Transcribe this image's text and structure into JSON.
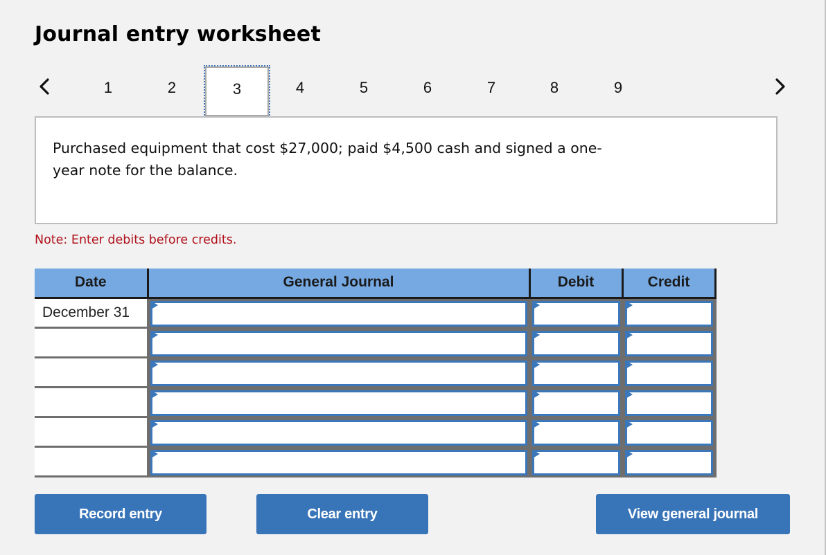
{
  "title": "Journal entry worksheet",
  "pager": {
    "prev_icon": "chevron-left-icon",
    "next_icon": "chevron-right-icon",
    "pages": [
      "1",
      "2",
      "3",
      "4",
      "5",
      "6",
      "7",
      "8",
      "9"
    ],
    "active_page": "3"
  },
  "description": "Purchased equipment that cost $27,000; paid $4,500 cash and signed a one-year note for the balance.",
  "description_lines": [
    "Purchased equipment that cost $27,000; paid $4,500 cash and signed a one-",
    "year note for the balance."
  ],
  "note": "Note: Enter debits before credits.",
  "table": {
    "headers": {
      "date": "Date",
      "general_journal": "General Journal",
      "debit": "Debit",
      "credit": "Credit"
    },
    "rows": [
      {
        "date": "December 31",
        "account": "",
        "debit": "",
        "credit": ""
      },
      {
        "date": "",
        "account": "",
        "debit": "",
        "credit": ""
      },
      {
        "date": "",
        "account": "",
        "debit": "",
        "credit": ""
      },
      {
        "date": "",
        "account": "",
        "debit": "",
        "credit": ""
      },
      {
        "date": "",
        "account": "",
        "debit": "",
        "credit": ""
      },
      {
        "date": "",
        "account": "",
        "debit": "",
        "credit": ""
      }
    ]
  },
  "buttons": {
    "record": "Record entry",
    "clear": "Clear entry",
    "view": "View general journal"
  },
  "colors": {
    "header_bg": "#76a9e2",
    "button_bg": "#3874b8",
    "note_text": "#b0101a",
    "input_border": "#3a77bb"
  }
}
